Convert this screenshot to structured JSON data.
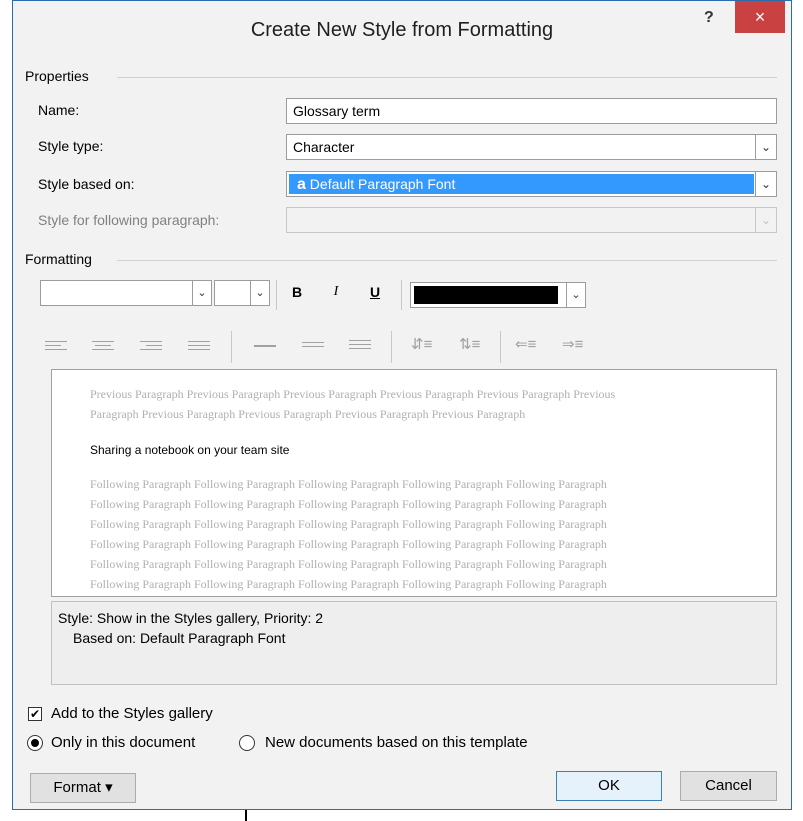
{
  "dialog": {
    "title": "Create New Style from Formatting",
    "help": "?",
    "close": "×"
  },
  "properties": {
    "group_label": "Properties",
    "name_label": "Name:",
    "name_value": "Glossary term",
    "style_type_label": "Style type:",
    "style_type_value": "Character",
    "based_on_label": "Style based on:",
    "based_on_icon": "a",
    "based_on_value": "Default Paragraph Font",
    "following_label": "Style for following paragraph:",
    "following_value": ""
  },
  "formatting": {
    "group_label": "Formatting",
    "font_value": "",
    "size_value": "",
    "bold": "B",
    "italic": "I",
    "underline": "U",
    "font_color": "#000000"
  },
  "preview": {
    "previous_lines": [
      "Previous Paragraph Previous Paragraph Previous Paragraph Previous Paragraph Previous Paragraph Previous",
      "Paragraph Previous Paragraph Previous Paragraph Previous Paragraph Previous Paragraph"
    ],
    "sample_text": "Sharing a notebook on your team site",
    "following_lines": [
      "Following Paragraph Following Paragraph Following Paragraph Following Paragraph Following Paragraph",
      "Following Paragraph Following Paragraph Following Paragraph Following Paragraph Following Paragraph",
      "Following Paragraph Following Paragraph Following Paragraph Following Paragraph Following Paragraph",
      "Following Paragraph Following Paragraph Following Paragraph Following Paragraph Following Paragraph",
      "Following Paragraph Following Paragraph Following Paragraph Following Paragraph Following Paragraph",
      "Following Paragraph Following Paragraph Following Paragraph Following Paragraph Following Paragraph"
    ]
  },
  "description": {
    "line1": "Style: Show in the Styles gallery, Priority: 2",
    "line2": "Based on: Default Paragraph Font"
  },
  "options": {
    "add_to_gallery": "Add to the Styles gallery",
    "add_to_gallery_checked": true,
    "only_this_document": "Only in this document",
    "new_documents": "New documents based on this template",
    "selected_scope": "only_this_document"
  },
  "buttons": {
    "format": "Format",
    "format_arrow": "▾",
    "ok": "OK",
    "cancel": "Cancel"
  },
  "colors": {
    "selection": "#3399ff",
    "close_button": "#c94141",
    "dialog_background": "#f2f2f2"
  }
}
